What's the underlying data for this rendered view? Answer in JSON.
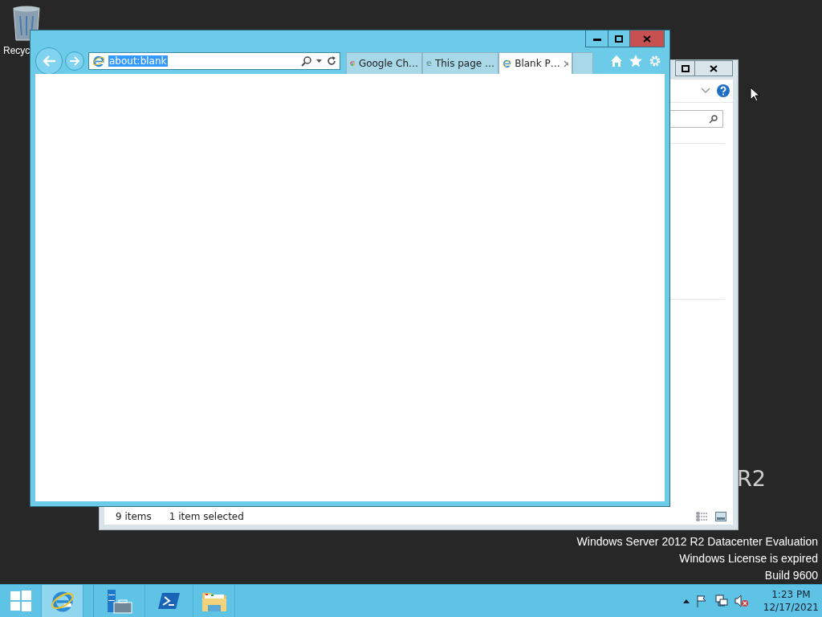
{
  "desktop": {
    "icons": [
      {
        "label": "Recyc"
      }
    ],
    "watermark": {
      "edition": "R2",
      "lines": [
        "Windows Server 2012 R2 Datacenter Evaluation",
        "Windows License is expired",
        "Build 9600"
      ]
    }
  },
  "explorer_window": {
    "status_bar": {
      "item_count": "9 items",
      "selection": "1 item selected"
    }
  },
  "browser_window": {
    "address_bar": {
      "value": "about:blank",
      "selected": true
    },
    "tabs": [
      {
        "label": "Google Ch…",
        "kind": "chrome",
        "selected": false
      },
      {
        "label": "This page …",
        "kind": "ie",
        "selected": false
      },
      {
        "label": "Blank P…",
        "kind": "ie",
        "selected": true
      }
    ]
  },
  "taskbar": {
    "apps": [
      {
        "kind": "ie",
        "selected": true
      },
      {
        "kind": "server-manager",
        "selected": false
      },
      {
        "kind": "powershell",
        "selected": false
      },
      {
        "kind": "file-explorer",
        "selected": false
      }
    ],
    "clock": {
      "time": "1:23 PM",
      "date": "12/17/2021"
    }
  }
}
